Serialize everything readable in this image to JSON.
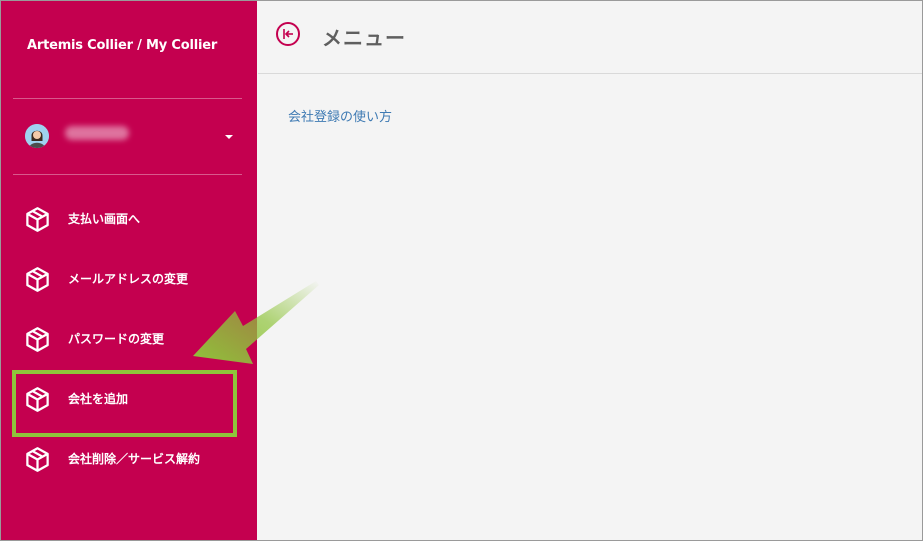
{
  "sidebar": {
    "app_title": "Artemis Collier / My Collier",
    "items": [
      {
        "label": "支払い画面へ",
        "icon": "package-icon"
      },
      {
        "label": "メールアドレスの変更",
        "icon": "package-icon"
      },
      {
        "label": "パスワードの変更",
        "icon": "package-icon"
      },
      {
        "label": "会社を追加",
        "icon": "package-icon"
      },
      {
        "label": "会社削除／サービス解約",
        "icon": "package-icon"
      }
    ]
  },
  "header": {
    "title": "メニュー"
  },
  "main": {
    "link_label": "会社登録の使い方"
  },
  "colors": {
    "sidebar_bg": "#c4004f",
    "highlight": "#8fc43b",
    "link": "#3e7ab3",
    "content_bg": "#f4f4f4"
  }
}
